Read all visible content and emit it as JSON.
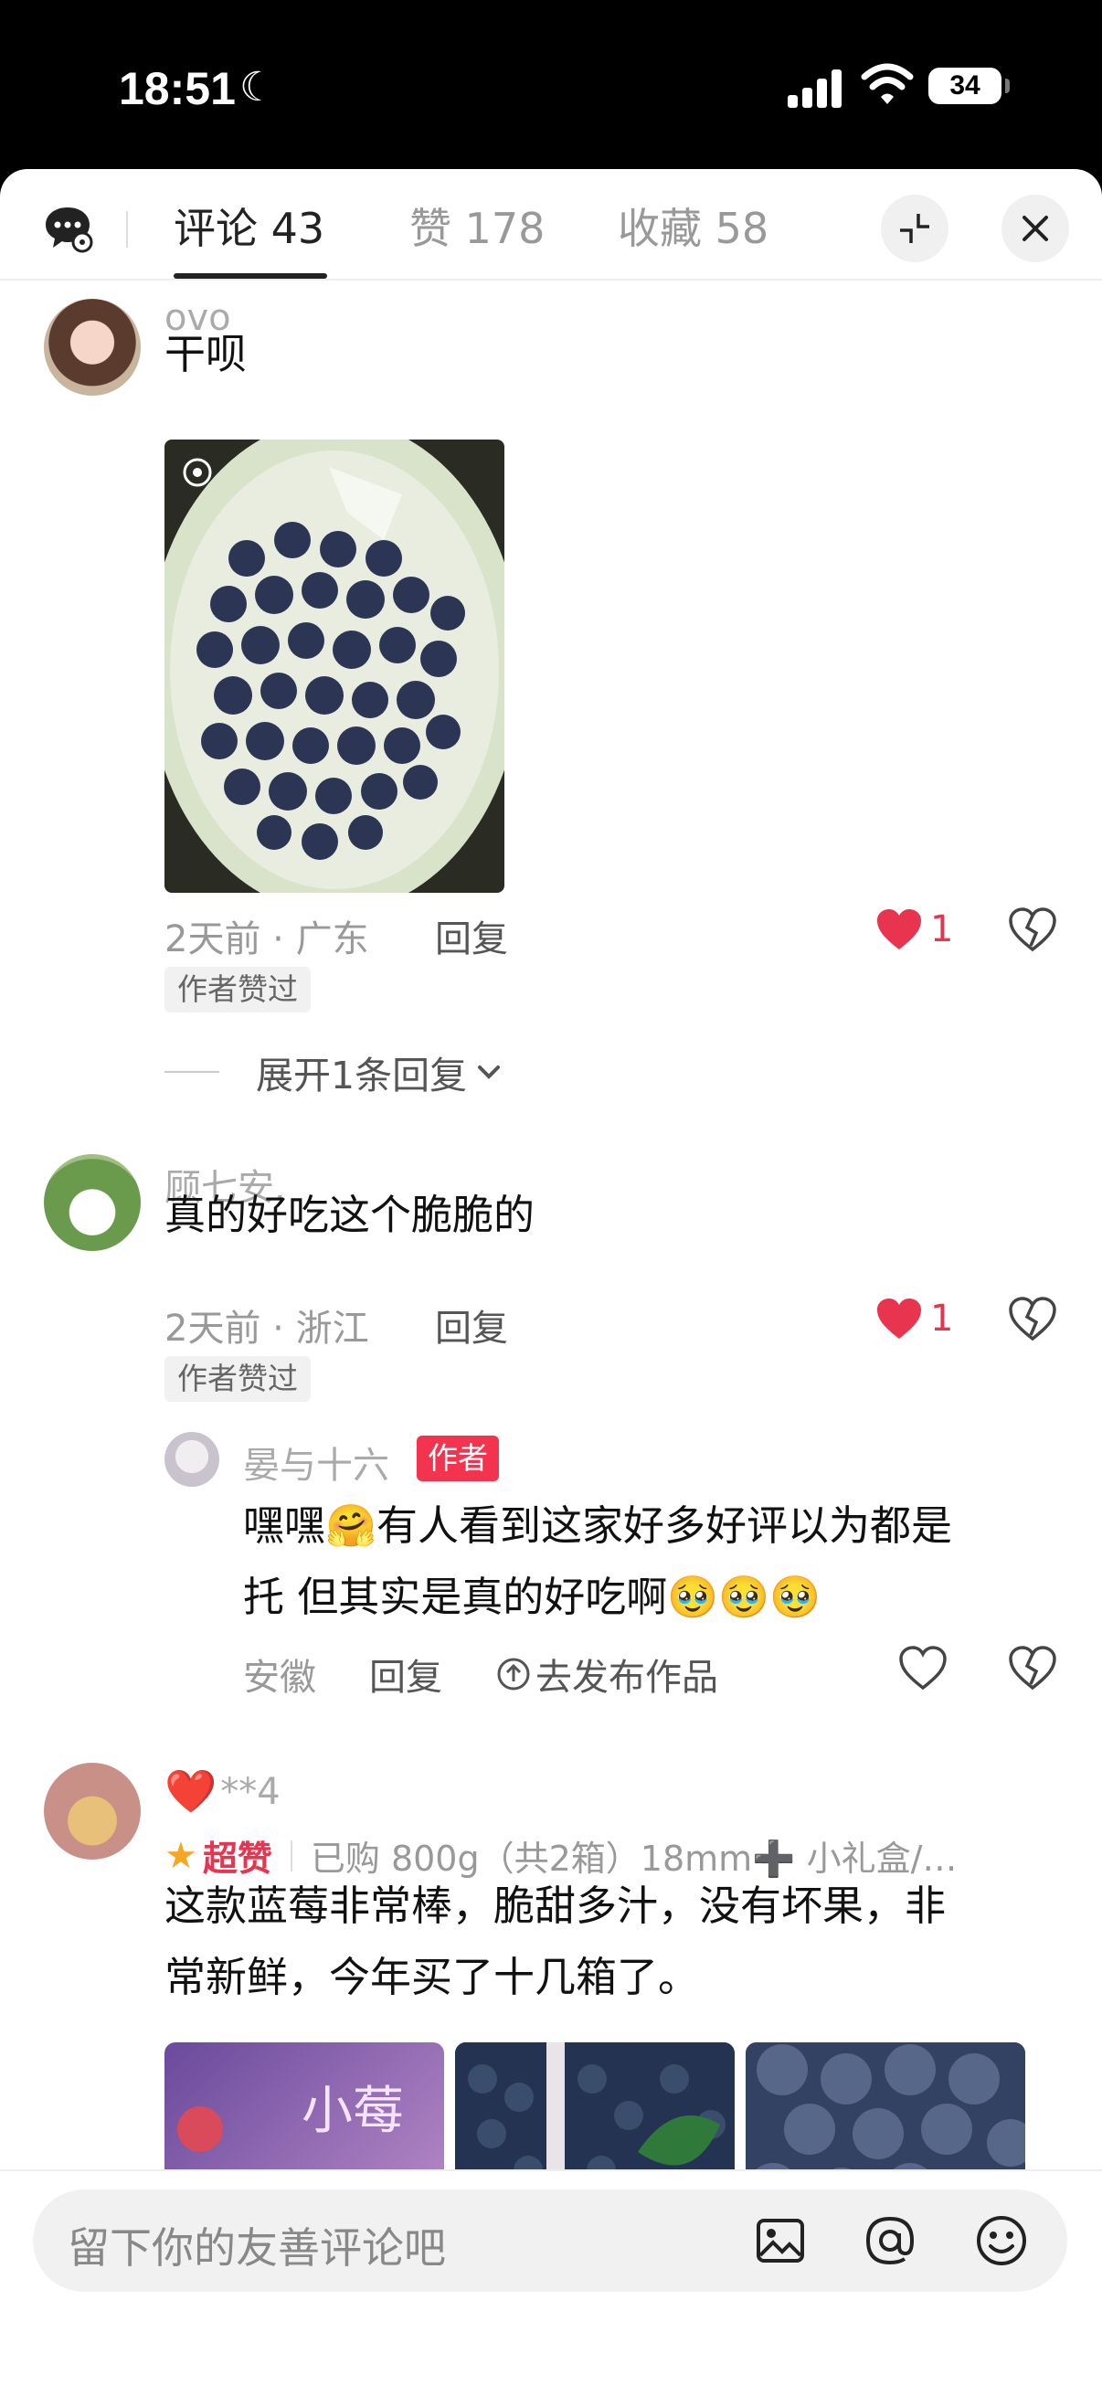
{
  "status_bar": {
    "time": "18:51",
    "battery": "34"
  },
  "tabs": [
    {
      "label": "评论 43",
      "active": true
    },
    {
      "label": "赞 178",
      "active": false
    },
    {
      "label": "收藏 58",
      "active": false
    }
  ],
  "comments": [
    {
      "name": "ovo",
      "text": "干呗",
      "meta": "2天前 · 广东",
      "reply_label": "回复",
      "likes": "1",
      "badge": "作者赞过",
      "expand": "展开1条回复"
    },
    {
      "name": "顾七安.",
      "text": "真的好吃这个脆脆的",
      "meta": "2天前 · 浙江",
      "reply_label": "回复",
      "likes": "1",
      "badge": "作者赞过",
      "sub_reply": {
        "name": "晏与十六",
        "tag": "作者",
        "line1": "嘿嘿🤗有人看到这家好多好评以为都是",
        "line2": "托 但其实是真的好吃啊🥹🥹🥹",
        "meta": "安徽",
        "reply_label": "回复",
        "publish_label": "去发布作品"
      }
    },
    {
      "name_heart": "❤️",
      "name": "**4",
      "super_like": "超赞",
      "purchase": "已购 800g（共2箱）18mm➕ 小礼盒/…",
      "line1": "这款蓝莓非常棒，脆甜多汁，没有坏果，非",
      "line2": "常新鲜，今年买了十几箱了。",
      "image_text": "小莓"
    }
  ],
  "composer": {
    "placeholder": "留下你的友善评论吧"
  },
  "colors": {
    "accent": "#e8344e",
    "author_tag": "#f2344f"
  }
}
